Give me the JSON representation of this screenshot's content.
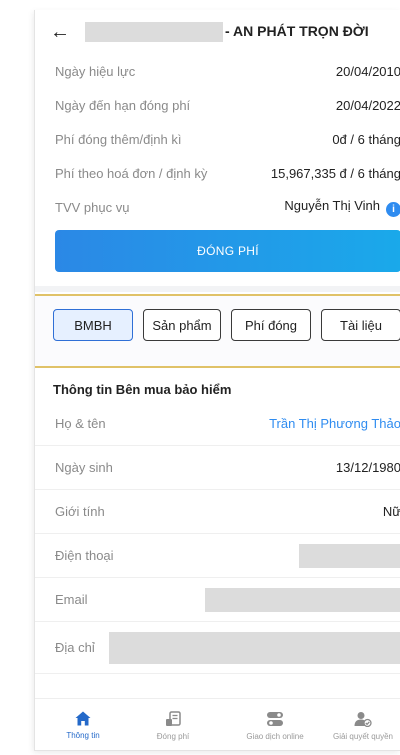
{
  "header": {
    "back_glyph": "←",
    "title": "- AN PHÁT TRỌN ĐỜI"
  },
  "policy": {
    "rows": [
      {
        "label": "Ngày hiệu lực",
        "value": "20/04/2010"
      },
      {
        "label": "Ngày đến hạn đóng phí",
        "value": "20/04/2022"
      },
      {
        "label": "Phí đóng thêm/định kì",
        "value": "0đ / 6 tháng"
      },
      {
        "label": "Phí theo hoá đơn / định kỳ",
        "value": "15,967,335 đ / 6 tháng"
      },
      {
        "label": "TVV phục vụ",
        "value": "Nguyễn Thị Vinh"
      }
    ],
    "info_glyph": "i",
    "pay_button": "ĐÓNG PHÍ"
  },
  "tabs": [
    {
      "label": "BMBH",
      "active": true
    },
    {
      "label": "Sản phẩm",
      "active": false
    },
    {
      "label": "Phí đóng",
      "active": false
    },
    {
      "label": "Tài liệu",
      "active": false
    }
  ],
  "buyer": {
    "section_title": "Thông tin Bên mua bảo hiểm",
    "rows": [
      {
        "label": "Họ & tên",
        "value": "Trần Thị Phương Thảo"
      },
      {
        "label": "Ngày sinh",
        "value": "13/12/1980"
      },
      {
        "label": "Giới tính",
        "value": "Nữ"
      },
      {
        "label": "Điện thoại",
        "value": ""
      },
      {
        "label": "Email",
        "value": ""
      },
      {
        "label": "Địa chỉ",
        "value": ""
      }
    ]
  },
  "bottom_nav": [
    {
      "label": "Thông tin",
      "icon": "home-icon",
      "active": true
    },
    {
      "label": "Đóng phí",
      "icon": "receipt-icon",
      "active": false
    },
    {
      "label": "Giao dịch online",
      "icon": "toggle-icon",
      "active": false
    },
    {
      "label": "Giải quyết quyền",
      "icon": "user-check-icon",
      "active": false
    }
  ],
  "colors": {
    "accent": "#2f8cf0",
    "nav_active": "#2469c9",
    "highlight_border": "#e0c268",
    "button_gradient_start": "#2b88e6",
    "button_gradient_end": "#1aa9ea"
  }
}
